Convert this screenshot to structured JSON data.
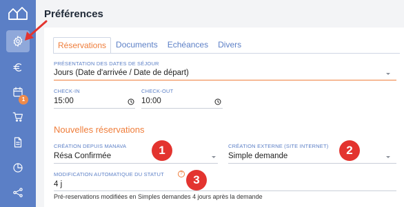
{
  "page": {
    "title": "Préférences"
  },
  "colors": {
    "sidebar": "#5b7fc6",
    "accent": "#ef7d3a",
    "badge": "#e3342f"
  },
  "sidebar": {
    "items": [
      {
        "icon": "gear-icon",
        "active": true
      },
      {
        "icon": "euro-icon"
      },
      {
        "icon": "calendar-icon",
        "badge": "1"
      },
      {
        "icon": "cart-icon"
      },
      {
        "icon": "document-icon"
      },
      {
        "icon": "pie-chart-icon"
      },
      {
        "icon": "share-icon"
      }
    ]
  },
  "tabs": [
    {
      "label": "Réservations",
      "active": true
    },
    {
      "label": "Documents"
    },
    {
      "label": "Echéances"
    },
    {
      "label": "Divers"
    }
  ],
  "form": {
    "date_presentation": {
      "label": "Présentation des dates de séjour",
      "value": "Jours (Date d'arrivée / Date de départ)"
    },
    "checkin": {
      "label": "Check-in",
      "value": "15:00"
    },
    "checkout": {
      "label": "Check-out",
      "value": "10:00"
    }
  },
  "new_reservations": {
    "title": "Nouvelles réservations",
    "creation_manava": {
      "label": "Création depuis Manava",
      "value": "Résa Confirmée"
    },
    "creation_externe": {
      "label": "Création externe (site internet)",
      "value": "Simple demande"
    },
    "auto_status": {
      "label": "Modification automatique du statut",
      "help": "?",
      "value": "4 j"
    },
    "hint": "Pré-reservations modifiées en Simples demandes 4 jours après la demande"
  },
  "annotations": [
    "1",
    "2",
    "3"
  ]
}
